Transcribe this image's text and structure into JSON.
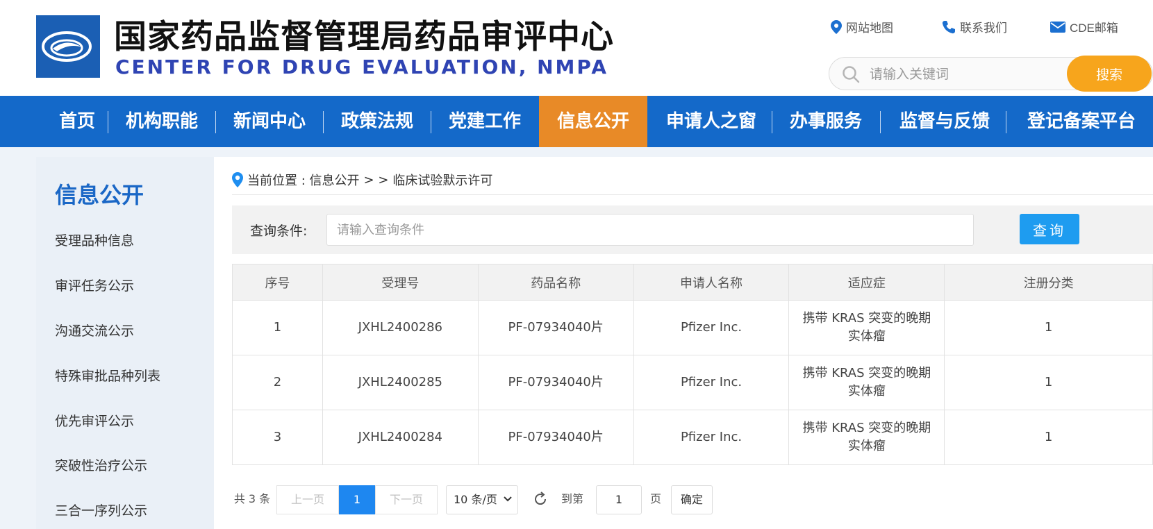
{
  "site": {
    "title_cn": "国家药品监督管理局药品审评中心",
    "title_en": "CENTER FOR DRUG EVALUATION, NMPA"
  },
  "top_links": [
    {
      "label": "网站地图",
      "icon": "location-pin-icon"
    },
    {
      "label": "联系我们",
      "icon": "phone-icon"
    },
    {
      "label": "CDE邮箱",
      "icon": "mail-icon"
    }
  ],
  "search": {
    "placeholder": "请输入关键词",
    "button_label": "搜索"
  },
  "nav": {
    "items": [
      {
        "label": "首页"
      },
      {
        "label": "机构职能"
      },
      {
        "label": "新闻中心"
      },
      {
        "label": "政策法规"
      },
      {
        "label": "党建工作"
      },
      {
        "label": "信息公开"
      },
      {
        "label": "申请人之窗"
      },
      {
        "label": "办事服务"
      },
      {
        "label": "监督与反馈"
      },
      {
        "label": "登记备案平台"
      }
    ],
    "active_index": 5
  },
  "sidebar": {
    "title": "信息公开",
    "items": [
      {
        "label": "受理品种信息"
      },
      {
        "label": "审评任务公示"
      },
      {
        "label": "沟通交流公示"
      },
      {
        "label": "特殊审批品种列表"
      },
      {
        "label": "优先审评公示"
      },
      {
        "label": "突破性治疗公示"
      },
      {
        "label": "三合一序列公示"
      }
    ]
  },
  "breadcrumb": {
    "prefix": "当前位置 : 信息公开",
    "separator": "> >",
    "current": "临床试验默示许可"
  },
  "query": {
    "label": "查询条件:",
    "placeholder": "请输入查询条件",
    "button_label": "查询"
  },
  "table": {
    "columns": [
      "序号",
      "受理号",
      "药品名称",
      "申请人名称",
      "适应症",
      "注册分类"
    ],
    "rows": [
      {
        "no": "1",
        "acceptance_no": "JXHL2400286",
        "drug_name": "PF-07934040片",
        "applicant": "Pfizer Inc.",
        "indication_l1": "携带 KRAS 突变的晚期",
        "indication_l2": "实体瘤",
        "category": "1"
      },
      {
        "no": "2",
        "acceptance_no": "JXHL2400285",
        "drug_name": "PF-07934040片",
        "applicant": "Pfizer Inc.",
        "indication_l1": "携带 KRAS 突变的晚期",
        "indication_l2": "实体瘤",
        "category": "1"
      },
      {
        "no": "3",
        "acceptance_no": "JXHL2400284",
        "drug_name": "PF-07934040片",
        "applicant": "Pfizer Inc.",
        "indication_l1": "携带 KRAS 突变的晚期",
        "indication_l2": "实体瘤",
        "category": "1"
      }
    ]
  },
  "pager": {
    "total": "共 3 条",
    "prev": "上一页",
    "current_page": "1",
    "next": "下一页",
    "page_size": "10 条/页",
    "goto_prefix": "到第",
    "goto_value": "1",
    "goto_suffix": "页",
    "confirm": "确定"
  },
  "colors": {
    "nav_bg": "#1469c9",
    "nav_active": "#e88a27",
    "search_button": "#f7a51c",
    "query_button": "#1e9cf0",
    "title_en": "#2f44b3",
    "sidebar_title": "#1a67c6"
  }
}
